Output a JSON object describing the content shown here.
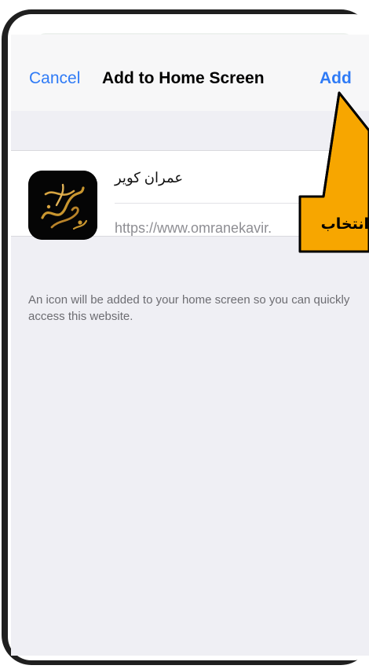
{
  "nav": {
    "cancel_label": "Cancel",
    "title": "Add to Home Screen",
    "add_label": "Add"
  },
  "shortcut": {
    "name": "عمران کویر",
    "url": "https://www.omranekavir.",
    "icon": "omranekavir-calligraphy-logo"
  },
  "description": "An icon will be added to your home screen so you can quickly access this website.",
  "callout": {
    "text": "انتخاب",
    "color": "#f7a600"
  },
  "colors": {
    "accent": "#2f7bf6"
  }
}
